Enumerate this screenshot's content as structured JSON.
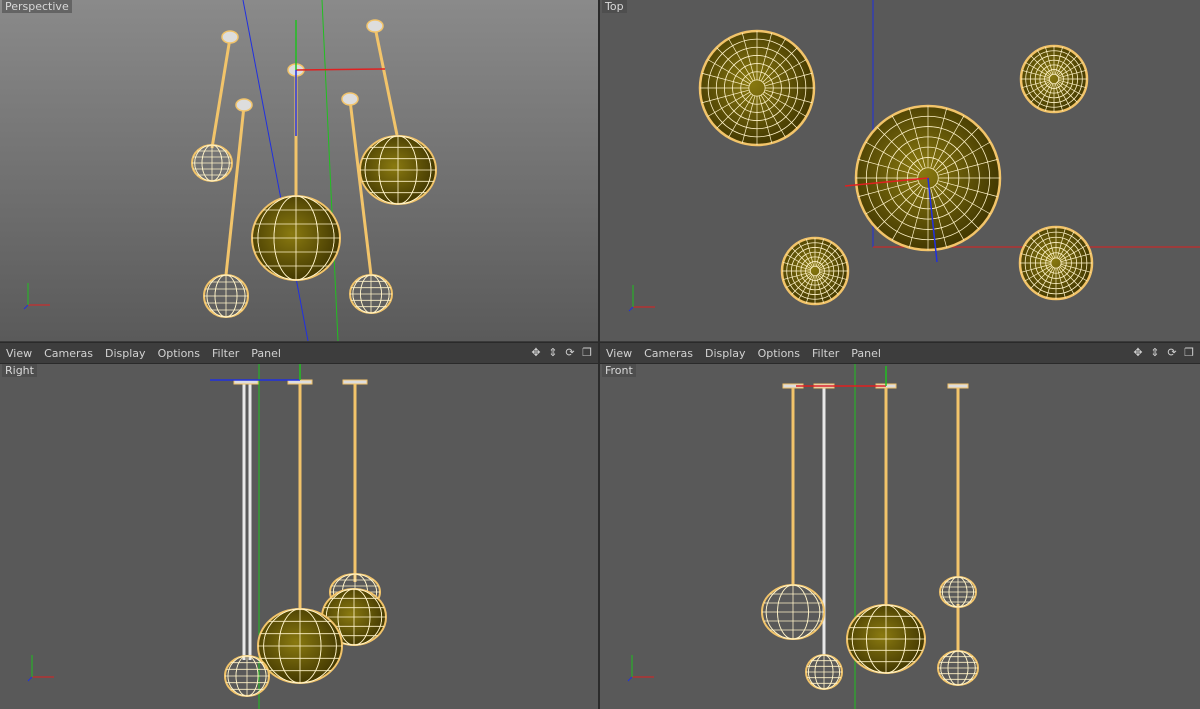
{
  "viewports": {
    "perspective": {
      "label": "Perspective"
    },
    "top": {
      "label": "Top"
    },
    "right": {
      "label": "Right"
    },
    "front": {
      "label": "Front"
    }
  },
  "menus": {
    "items": [
      "View",
      "Cameras",
      "Display",
      "Options",
      "Filter",
      "Panel"
    ]
  },
  "nav_icons": [
    "move-view-icon",
    "dolly-view-icon",
    "rotate-view-icon",
    "maximize-view-icon"
  ],
  "colors": {
    "wire": "#f2c46a",
    "wire_light": "#fff3c8",
    "fill_dark": "#3d3300",
    "fill_mid": "#8a7a10",
    "axis_x": "#e02020",
    "axis_y": "#20c020",
    "axis_z": "#2030e0"
  }
}
